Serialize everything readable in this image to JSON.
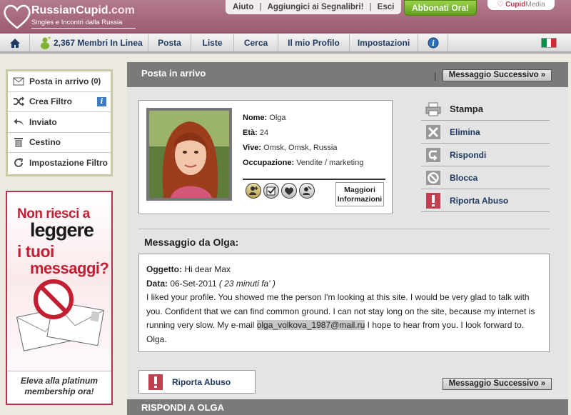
{
  "header": {
    "logo_main": "RussianCupid",
    "logo_domain": ".com",
    "tagline": "Singles e Incontri dalla Russia",
    "links": [
      "Aiuto",
      "Aggiungici ai Segnalibri!",
      "Esci"
    ],
    "upgrade_button": "Abbonati Ora!",
    "network_brand": "Cupid",
    "network_suffix": "Media"
  },
  "nav": {
    "online_count": "2,367 Membri In Linea",
    "items": [
      "Posta",
      "Liste",
      "Cerca",
      "Il mio Profilo",
      "Impostazioni"
    ],
    "colors": {
      "flag_green": "#009246",
      "flag_white": "#ffffff",
      "flag_red": "#ce2b37"
    }
  },
  "sidebar": {
    "items": [
      {
        "label": "Posta in arrivo",
        "count": "(0)",
        "icon": "envelope-icon"
      },
      {
        "label": "Crea Filtro",
        "icon": "shuffle-icon"
      },
      {
        "label": "Inviato",
        "icon": "reply-arrow-icon"
      },
      {
        "label": "Cestino",
        "icon": "trash-icon"
      },
      {
        "label": "Impostazione Filtro",
        "icon": "refresh-icon"
      }
    ],
    "info_glyph": "i"
  },
  "promo": {
    "line1": "Non riesci a",
    "line2": "leggere",
    "line3": "i tuoi",
    "line4": "messaggi?",
    "footer_line1": "Eleva alla platinum",
    "footer_line2": "membership ora!"
  },
  "main": {
    "title": "Posta in arrivo",
    "separator": "|",
    "next_message": "Messaggio Successivo »",
    "profile": {
      "name_label": "Nome:",
      "name": "Olga",
      "age_label": "Età:",
      "age": "24",
      "location_label": "Vive:",
      "location": "Omsk, Omsk, Russia",
      "job_label": "Occupazione:",
      "job": "Vendite / marketing",
      "more_info_1": "Maggiori",
      "more_info_2": "Informazioni"
    },
    "actions": [
      "Stampa",
      "Elimina",
      "Rispondi",
      "Blocca",
      "Riporta Abuso"
    ],
    "message": {
      "heading": "Messaggio da Olga:",
      "subject_label": "Oggetto:",
      "subject": "Hi dear Max",
      "date_label": "Data:",
      "date": "06-Set-2011",
      "ago": "( 23 minuti fa' )",
      "body_1": "I liked your profile. You showed me the person I'm looking at this site. I would be very glad to talk with you. Confident that we can find common ground. I can not stay long on the site, because my internet is running very slow. My e-mail ",
      "email": "olga_volkova_1987@mail.ru",
      "body_2": " I hope to hear from you. I look forward to. Olga."
    },
    "report_button": "Riporta Abuso",
    "reply_title": "RISPONDI A OLGA"
  }
}
